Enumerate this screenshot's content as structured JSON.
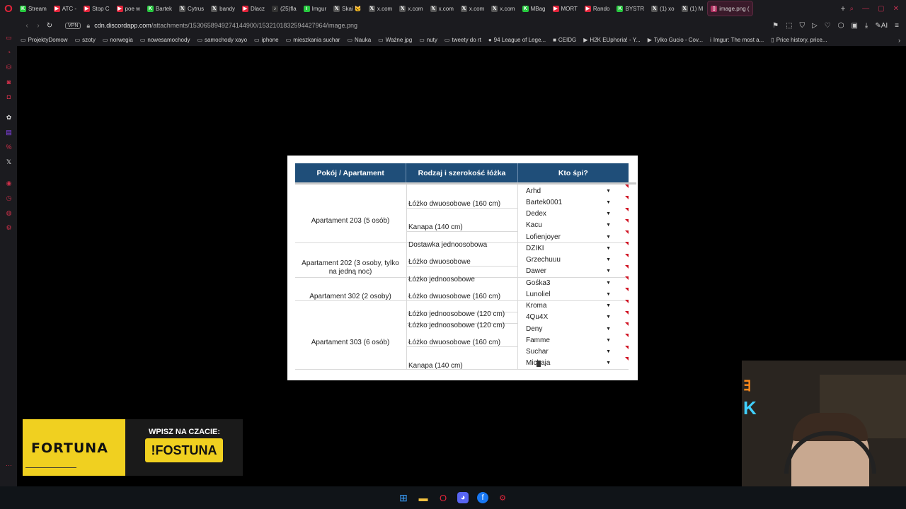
{
  "tabs": [
    {
      "label": "Stream",
      "color": "#27c93f",
      "icon": "K"
    },
    {
      "label": "ATC - ",
      "color": "#e0243a",
      "icon": "▶"
    },
    {
      "label": "Stop C",
      "color": "#e0243a",
      "icon": "▶"
    },
    {
      "label": "poe w",
      "color": "#e0243a",
      "icon": "▶"
    },
    {
      "label": "Bartek",
      "color": "#27c93f",
      "icon": "K"
    },
    {
      "label": "Cytrus",
      "color": "#555555",
      "icon": "𝕏"
    },
    {
      "label": "bandy",
      "color": "#555555",
      "icon": "𝕏"
    },
    {
      "label": "Dlacz",
      "color": "#e0243a",
      "icon": "▶"
    },
    {
      "label": "(25)fla",
      "color": "#333333",
      "icon": "♪"
    },
    {
      "label": "Imgur",
      "color": "#27c93f",
      "icon": "i"
    },
    {
      "label": "Skai 🐱",
      "color": "#555555",
      "icon": "𝕏"
    },
    {
      "label": "x.com",
      "color": "#555555",
      "icon": "𝕏"
    },
    {
      "label": "x.com",
      "color": "#555555",
      "icon": "𝕏"
    },
    {
      "label": "x.com",
      "color": "#555555",
      "icon": "𝕏"
    },
    {
      "label": "x.com",
      "color": "#555555",
      "icon": "𝕏"
    },
    {
      "label": "x.com",
      "color": "#555555",
      "icon": "𝕏"
    },
    {
      "label": "MBag",
      "color": "#27c93f",
      "icon": "K"
    },
    {
      "label": "MORT",
      "color": "#e0243a",
      "icon": "▶"
    },
    {
      "label": "Rando",
      "color": "#e0243a",
      "icon": "▶"
    },
    {
      "label": "BYSTR",
      "color": "#27c93f",
      "icon": "K"
    },
    {
      "label": "(1) xo",
      "color": "#555555",
      "icon": "𝕏"
    },
    {
      "label": "(1) M",
      "color": "#555555",
      "icon": "𝕏"
    },
    {
      "label": "image.png (",
      "color": "#b03060",
      "icon": "▯",
      "active": true
    }
  ],
  "address": {
    "vpn": "VPN",
    "host": "cdn.discordapp.com",
    "path": "/attachments/1530658949274144900/1532101832594427964/image.png"
  },
  "bookmarks": [
    {
      "label": "ProjektyDomow",
      "icon": "▭"
    },
    {
      "label": "szoty",
      "icon": "▭"
    },
    {
      "label": "norwegia",
      "icon": "▭"
    },
    {
      "label": "nowesamochody",
      "icon": "▭"
    },
    {
      "label": "samochody xayo",
      "icon": "▭"
    },
    {
      "label": "iphone",
      "icon": "▭"
    },
    {
      "label": "mieszkania suchar",
      "icon": "▭"
    },
    {
      "label": "Nauka",
      "icon": "▭"
    },
    {
      "label": "Ważne jpg",
      "icon": "▭"
    },
    {
      "label": "nuty",
      "icon": "▭"
    },
    {
      "label": "tweety do rt",
      "icon": "▭"
    },
    {
      "label": "94 League of Lege...",
      "icon": "●"
    },
    {
      "label": "CEIDG",
      "icon": "■"
    },
    {
      "label": "H2K EUphoria! - Y...",
      "icon": "▶"
    },
    {
      "label": "Tylko Gucio - Cov...",
      "icon": "▶"
    },
    {
      "label": "Imgur: The most a...",
      "icon": "i"
    },
    {
      "label": "Price history, price...",
      "icon": "▯"
    }
  ],
  "sheet": {
    "headers": [
      "Pokój / Apartament",
      "Rodzaj i szerokość łóżka",
      "Kto śpi?"
    ],
    "rooms": [
      {
        "name": "Apartament 203 (5 osób)"
      },
      {
        "name": "Apartament 202 (3 osoby, tylko na jedną noc)"
      },
      {
        "name": "Apartament 302 (2 osoby)"
      },
      {
        "name": "Apartament 303 (6 osób)"
      }
    ],
    "beds": [
      "Łóżko dwuosobowe (160 cm)",
      "Kanapa (140 cm)",
      "Dostawka jednoosobowa",
      "Łóżko dwuosobowe",
      "Łóżko jednoosobowe",
      "Łóżko dwuosobowe (160 cm)",
      "Łóżko jednoosobowe (120 cm)",
      "Łóżko jednoosobowe (120 cm)",
      "Łóżko dwuosobowe (160 cm)",
      "Kanapa (140 cm)"
    ],
    "people": [
      "Arhd",
      "Bartek0001",
      "Dedex",
      "Kacu",
      "Lofienjoyer",
      "DZIKI",
      "Grzechuuu",
      "Dawer",
      "Gośka3",
      "Lunoliel",
      "Kroma",
      "4Qu4X",
      "Deny",
      "Famme",
      "Suchar",
      "Michaja"
    ]
  },
  "ad": {
    "brand": "FORTUNA",
    "title": "WPISZ NA CZACIE:",
    "command": "!FOSTUNA"
  },
  "colors": {
    "header_bg": "#1f4e79",
    "accent": "#e0243a",
    "ad_yellow": "#f0d020"
  }
}
